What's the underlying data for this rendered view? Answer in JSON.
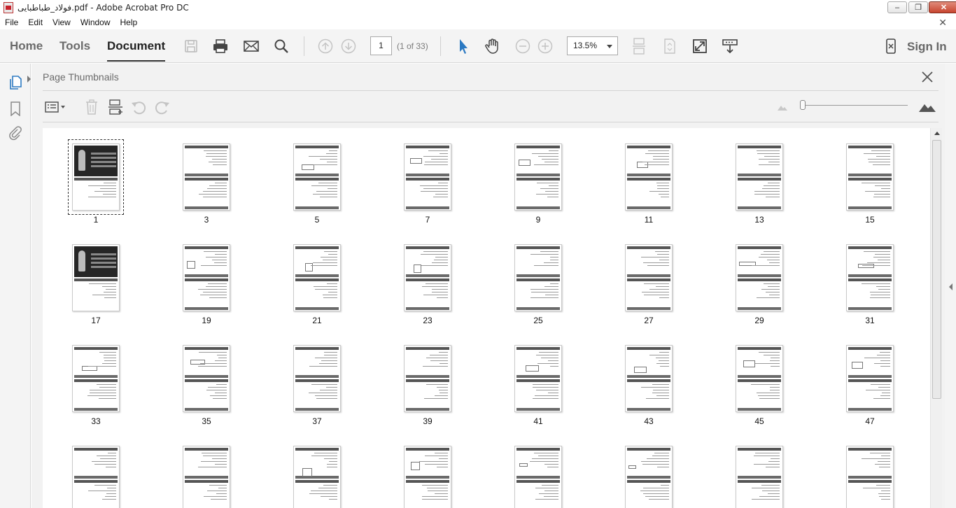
{
  "window": {
    "title": "فولاد_طباطبایی.pdf - Adobe Acrobat Pro DC",
    "controls": [
      "minimize",
      "restore",
      "close"
    ]
  },
  "menu": [
    "File",
    "Edit",
    "View",
    "Window",
    "Help"
  ],
  "toolbar": {
    "tabs": [
      "Home",
      "Tools",
      "Document"
    ],
    "active_tab": "Document",
    "page_value": "1",
    "page_count": "(1 of 33)",
    "zoom": "13.5%",
    "sign_in": "Sign In",
    "icons": [
      "save-icon",
      "print-icon",
      "email-icon",
      "search-icon",
      "prev-page-icon",
      "next-page-icon",
      "select-cursor-icon",
      "hand-icon",
      "zoom-out-icon",
      "zoom-in-icon",
      "scrolling-mode-icon",
      "page-display-icon",
      "full-screen-icon",
      "read-mode-icon",
      "mobile-link-icon"
    ]
  },
  "left_rail": {
    "icons": [
      "page-thumbnails-icon",
      "bookmarks-icon",
      "attachments-icon"
    ]
  },
  "panel": {
    "title": "Page Thumbnails",
    "tools": [
      "thumbnail-options-icon",
      "delete-page-icon",
      "insert-page-icon",
      "rotate-ccw-icon",
      "rotate-cw-icon"
    ],
    "thumbnail_size_min": "small-mountain-icon",
    "thumbnail_size_max": "large-mountain-icon"
  },
  "thumbnails": {
    "row1": [
      "1",
      "3",
      "5",
      "7",
      "9",
      "11",
      "13",
      "15"
    ],
    "row2": [
      "17",
      "19",
      "21",
      "23",
      "25",
      "27",
      "29",
      "31"
    ],
    "row3": [
      "33",
      "35",
      "37",
      "39",
      "41",
      "43",
      "45",
      "47"
    ],
    "row4": [
      "",
      "",
      "",
      "",
      "",
      "",
      "",
      ""
    ],
    "selected": "1",
    "cover_pages": [
      "1",
      "17"
    ]
  },
  "colors": {
    "accent_blue": "#2b79c2",
    "toolbar_bg": "#f4f4f4",
    "panel_bg": "#f2f2f2",
    "close_red": "#c8452f"
  }
}
